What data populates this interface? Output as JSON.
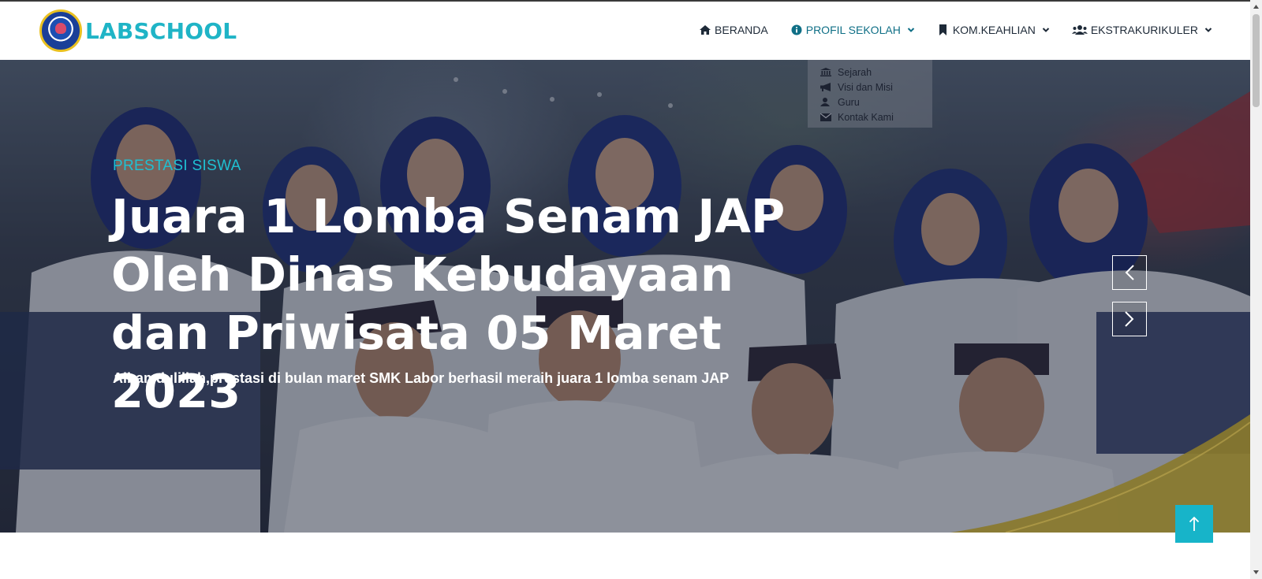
{
  "brand": {
    "name": "LABSCHOOL"
  },
  "nav": {
    "items": [
      {
        "label": "BERANDA",
        "icon": "home-icon"
      },
      {
        "label": "PROFIL SEKOLAH",
        "icon": "info-circle-icon",
        "has_dropdown": true,
        "active": true
      },
      {
        "label": "KOM.KEAHLIAN",
        "icon": "bookmark-icon",
        "has_dropdown": true
      },
      {
        "label": "EKSTRAKURIKULER",
        "icon": "users-icon",
        "has_dropdown": true
      }
    ]
  },
  "dropdown": {
    "items": [
      {
        "label": "Sejarah",
        "icon": "landmark-icon"
      },
      {
        "label": "Visi dan Misi",
        "icon": "megaphone-icon"
      },
      {
        "label": "Guru",
        "icon": "user-icon"
      },
      {
        "label": "Kontak Kami",
        "icon": "envelope-icon"
      }
    ]
  },
  "hero": {
    "subtitle": "PRESTASI SISWA",
    "title": "Juara 1 Lomba Senam JAP Oleh Dinas Kebudayaan dan Priwisata 05 Maret 2023",
    "description": "Alhamdulillah,prestasi di bulan maret SMK Labor berhasil meraih juara 1 lomba senam JAP"
  },
  "colors": {
    "accent": "#1fb4c6",
    "back_to_top": "#17b4c9",
    "swoosh": "#8a7a2c"
  }
}
